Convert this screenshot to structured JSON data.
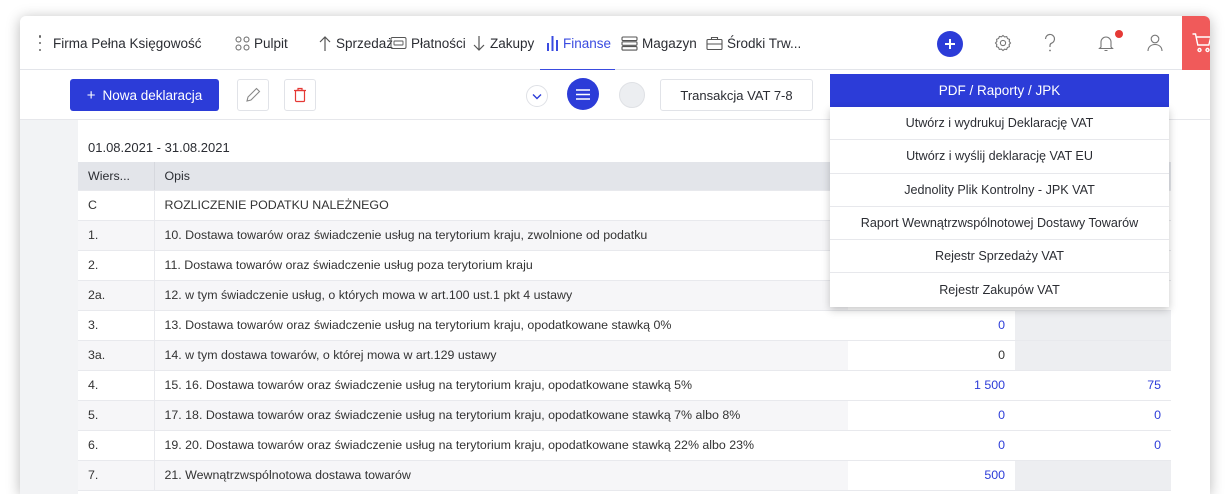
{
  "topbar": {
    "company": "Firma Pełna Księgowość",
    "nav": [
      {
        "label": "Pulpit",
        "icon": "dashboard-icon"
      },
      {
        "label": "Sprzedaż",
        "icon": "arrow-up-icon"
      },
      {
        "label": "Płatności",
        "icon": "payment-card-icon"
      },
      {
        "label": "Zakupy",
        "icon": "arrow-down-icon"
      },
      {
        "label": "Finanse",
        "icon": "bar-chart-icon",
        "active": true
      },
      {
        "label": "Magazyn",
        "icon": "warehouse-icon"
      },
      {
        "label": "Środki Trw...",
        "icon": "fixed-assets-icon"
      }
    ],
    "right_icons": [
      "add-icon",
      "settings-icon",
      "help-icon",
      "notifications-icon",
      "user-icon",
      "cart-icon"
    ]
  },
  "toolbar": {
    "new_declaration": "+ Nowa deklaracja",
    "new_declaration_text": "Nowa deklaracja",
    "transaction": "Transakcja VAT 7-8",
    "pdf_button": "PDF / Raporty / JPK"
  },
  "dropdown": {
    "items": [
      "Utwórz i wydrukuj Deklarację VAT",
      "Utwórz i wyślij deklarację VAT EU",
      "Jednolity Plik Kontrolny - JPK VAT",
      "Raport Wewnątrzwspólnotowej Dostawy Towarów",
      "Rejestr Sprzedaży VAT",
      "Rejestr Zakupów VAT"
    ]
  },
  "content": {
    "period": "01.08.2021 - 31.08.2021",
    "columns": {
      "wiersz": "Wiers...",
      "opis": "Opis"
    },
    "rows": [
      {
        "w": "C",
        "opis": "ROZLICZENIE PODATKU NALEŻNEGO",
        "base": "",
        "tax": ""
      },
      {
        "w": "1.",
        "opis": "10. Dostawa towarów oraz świadczenie usług na terytorium kraju, zwolnione od podatku",
        "base": "",
        "tax": ""
      },
      {
        "w": "2.",
        "opis": "11. Dostawa towarów oraz świadczenie usług poza terytorium kraju",
        "base": "",
        "tax": ""
      },
      {
        "w": "2a.",
        "opis": "12. w tym świadczenie usług, o których mowa w art.100 ust.1 pkt 4 ustawy",
        "base": "",
        "tax": ""
      },
      {
        "w": "3.",
        "opis": "13. Dostawa towarów oraz świadczenie usług na terytorium kraju, opodatkowane stawką 0%",
        "base": "0",
        "tax": ""
      },
      {
        "w": "3a.",
        "opis": "14. w tym dostawa towarów, o której mowa w art.129 ustawy",
        "base": "0",
        "tax": ""
      },
      {
        "w": "4.",
        "opis": "15. 16. Dostawa towarów oraz świadczenie usług na terytorium kraju, opodatkowane stawką 5%",
        "base": "1 500",
        "tax": "75"
      },
      {
        "w": "5.",
        "opis": "17. 18. Dostawa towarów oraz świadczenie usług na terytorium kraju, opodatkowane stawką 7% albo 8%",
        "base": "0",
        "tax": "0"
      },
      {
        "w": "6.",
        "opis": "19. 20. Dostawa towarów oraz świadczenie usług na terytorium kraju, opodatkowane stawką 22% albo 23%",
        "base": "0",
        "tax": "0"
      },
      {
        "w": "7.",
        "opis": "21. Wewnątrzwspólnotowa dostawa towarów",
        "base": "500",
        "tax": ""
      }
    ]
  },
  "colors": {
    "accent": "#2c3cd8",
    "cart": "#f05a5a",
    "notification": "#e53935"
  }
}
